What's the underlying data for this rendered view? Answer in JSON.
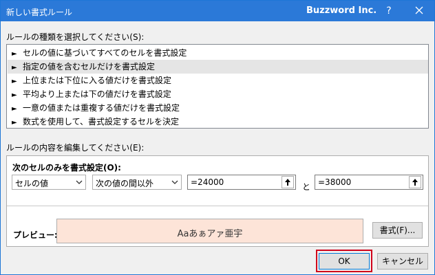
{
  "window": {
    "title": "新しい書式ルール",
    "brand": "Buzzword Inc.",
    "help_label": "?"
  },
  "rule_type": {
    "label": "ルールの種類を選択してください(S):",
    "items": [
      "セルの値に基づいてすべてのセルを書式設定",
      "指定の値を含むセルだけを書式設定",
      "上位または下位に入る値だけを書式設定",
      "平均より上または下の値だけを書式設定",
      "一意の値または重複する値だけを書式設定",
      "数式を使用して、書式設定するセルを決定"
    ],
    "selected_index": 1
  },
  "rule_edit": {
    "label": "ルールの内容を編集してください(E):",
    "heading": "次のセルのみを書式設定(O):",
    "condition_type": "セルの値",
    "operator": "次の値の間以外",
    "value1": "=24000",
    "connector": "と",
    "value2": "=38000"
  },
  "preview": {
    "label": "プレビュー:",
    "sample_text": "Aaあぁアァ亜宇",
    "format_button": "書式(F)..."
  },
  "buttons": {
    "ok": "OK",
    "cancel": "キャンセル"
  },
  "colors": {
    "titlebar": "#2b79d8",
    "preview_fill": "#fde4d8",
    "highlight": "#d0021b"
  }
}
